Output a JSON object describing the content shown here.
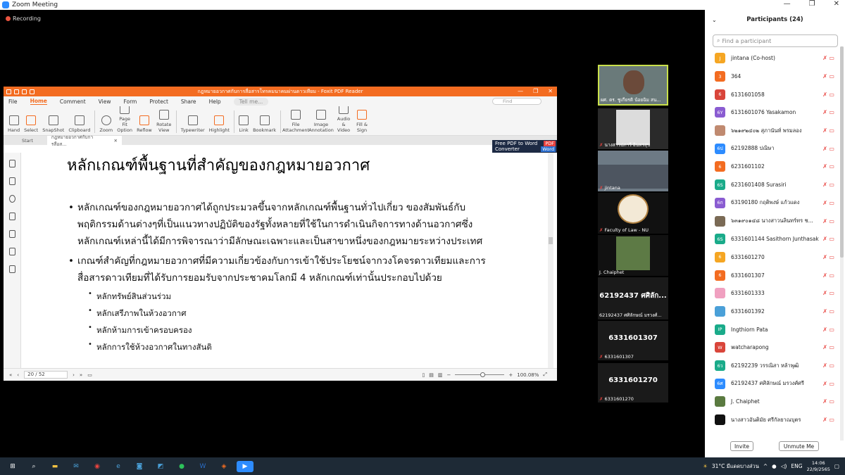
{
  "window": {
    "title": "Zoom Meeting",
    "recording": "Recording",
    "controls": [
      "—",
      "❐",
      "✕"
    ]
  },
  "foxit": {
    "title": "กฎหมายอวกาศกับการสื่อสารโทรคมนาคมผ่านดาวเทียม - Foxit PDF Reader",
    "menu": [
      "File",
      "Home",
      "Comment",
      "View",
      "Form",
      "Protect",
      "Share",
      "Help"
    ],
    "tell": "Tell me...",
    "find": "Find",
    "ribbon": [
      {
        "label": "Hand",
        "icon": "hand-icon"
      },
      {
        "label": "Select",
        "icon": "select-icon"
      },
      {
        "label": "SnapShot",
        "icon": "snapshot-icon"
      },
      {
        "label": "Clipboard",
        "icon": "clipboard-icon"
      },
      {
        "label": "Zoom",
        "icon": "zoom-icon"
      },
      {
        "label": "Page Fit Option",
        "icon": "page-fit-icon"
      },
      {
        "label": "Reflow",
        "icon": "reflow-icon"
      },
      {
        "label": "Rotate View",
        "icon": "rotate-icon"
      },
      {
        "label": "Typewriter",
        "icon": "typewriter-icon"
      },
      {
        "label": "Highlight",
        "icon": "highlight-icon"
      },
      {
        "label": "Link",
        "icon": "link-icon"
      },
      {
        "label": "Bookmark",
        "icon": "bookmark-icon"
      },
      {
        "label": "File Attachment",
        "icon": "attachment-icon"
      },
      {
        "label": "Image Annotation",
        "icon": "image-icon"
      },
      {
        "label": "Audio & Video",
        "icon": "audio-video-icon"
      },
      {
        "label": "Fill & Sign",
        "icon": "fill-sign-icon"
      }
    ],
    "tabs": {
      "start": "Start",
      "doc": "กฎหมายอวกาศกับการสื่อส..."
    },
    "ad": {
      "line1": "Free PDF to Word",
      "line2": "Converter",
      "badge1": "PDF",
      "badge2": "Word"
    },
    "slide": {
      "title": "หลักเกณฑ์พื้นฐานที่สำคัญของกฎหมายอวกาศ",
      "bullet1": [
        "หลักเกณฑ์ของกฎหมายอวกาศได้ถูกประมวลขึ้นจากหลักเกณฑ์พื้นฐานทั่วไปเกี่ยว ของสัมพันธ์กับ",
        "พฤติกรรมด้านต่างๆที่เป็นแนวทางปฏิบัติของรัฐทั้งหลายที่ใช้ในการดำเนินกิจการทางด้านอวกาศซึ่ง",
        "หลักเกณฑ์เหล่านี้ได้มีการพิจารณาว่ามีลักษณะเฉพาะและเป็นสาขาหนึ่งของกฎหมายระหว่างประเทศ"
      ],
      "bullet2": [
        "เกณฑ์สำคัญที่กฎหมายอวกาศที่มีความเกี่ยวข้องกับการเข้าใช้ประโยชน์จากวงโคจรดาวเทียมและการ",
        "สื่อสารดาวเทียมที่ได้รับการยอมรับจากประชาคมโลกมี 4 หลักเกณฑ์เท่านั้นประกอบไปด้วย"
      ],
      "subs": [
        "หลักทรัพย์สินส่วนร่วม",
        "หลักเสรีภาพในห้วงอวกาศ",
        "หลักห้ามการเข้าครอบครอง",
        "หลักการใช้ห้วงอวกาศในทางสันติ"
      ]
    },
    "status": {
      "page": "20 / 52",
      "zoom": "100.08%"
    }
  },
  "tiles": [
    {
      "name": "ผศ. ดร. ชูเกียรติ น้อยฉิม สน..."
    },
    {
      "name": "นางสาวปภาวี อินทรสุข"
    },
    {
      "name": "jintana"
    },
    {
      "name": "Faculty of Law - NU"
    },
    {
      "name": "J. Chaiphet"
    },
    {
      "big": "62192437 ศศิลัก...",
      "name": "62192437 ศศิลักษณ์ มรวงศ์..."
    },
    {
      "big": "6331601307",
      "name": "6331601307"
    },
    {
      "big": "6331601270",
      "name": "6331601270"
    }
  ],
  "participants": {
    "title": "Participants (24)",
    "search_placeholder": "Find a participant",
    "rows": [
      {
        "initials": "J",
        "color": "#f5a623",
        "name": "jintana (Co-host)"
      },
      {
        "initials": "3",
        "color": "#f36c21",
        "name": "364"
      },
      {
        "initials": "6",
        "color": "#d9453a",
        "name": "6131601058"
      },
      {
        "initials": "6Y",
        "color": "#8a5cd1",
        "name": "6131601076 Yasakamon"
      },
      {
        "initials": "",
        "color": "#c08a70",
        "name": "๖๒๑๙๒๔๐๒ สุภานันท์ พรมลอง"
      },
      {
        "initials": "6ป",
        "color": "#2d8cff",
        "name": "62192888 ปณิษา"
      },
      {
        "initials": "6",
        "color": "#f36c21",
        "name": "6231601102"
      },
      {
        "initials": "6S",
        "color": "#1aab8a",
        "name": "6231601408 Surasiri"
      },
      {
        "initials": "6ก",
        "color": "#8a5cd1",
        "name": "63190180 กฤติพงษ์ แก้วแดง"
      },
      {
        "initials": "",
        "color": "#7a6a55",
        "name": "๖๓๑๙๐๑๔๘ นางสาวนลินทร์ทร ช..."
      },
      {
        "initials": "6S",
        "color": "#1aab8a",
        "name": "6331601144 Sasithorn Junthasak"
      },
      {
        "initials": "6",
        "color": "#f5a623",
        "name": "6331601270"
      },
      {
        "initials": "6",
        "color": "#f36c21",
        "name": "6331601307"
      },
      {
        "initials": "",
        "color": "#f0a0c0",
        "name": "6331601333"
      },
      {
        "initials": "",
        "color": "#4aa0d8",
        "name": "6331601392"
      },
      {
        "initials": "IP",
        "color": "#1aab8a",
        "name": "Ingthiorn Pata"
      },
      {
        "initials": "W",
        "color": "#d9453a",
        "name": "watcharapong"
      },
      {
        "initials": "6ว",
        "color": "#1aab8a",
        "name": "62192239 วรรณิสา หล้าพุฒิ"
      },
      {
        "initials": "6ศ",
        "color": "#2d8cff",
        "name": "62192437 ศศิลักษณ์ มรวงศ์ศรี"
      },
      {
        "initials": "",
        "color": "#5a7a40",
        "name": "J. Chaiphet"
      },
      {
        "initials": "",
        "color": "#111111",
        "name": "นางสาวอันติมัย ศรีกัลยาณบุตร"
      }
    ],
    "invite": "Invite",
    "unmute": "Unmute Me"
  },
  "taskbar": {
    "weather": "31°C มีแดดบางส่วน",
    "lang": "ENG",
    "time": "14:06",
    "date": "22/9/2565"
  }
}
